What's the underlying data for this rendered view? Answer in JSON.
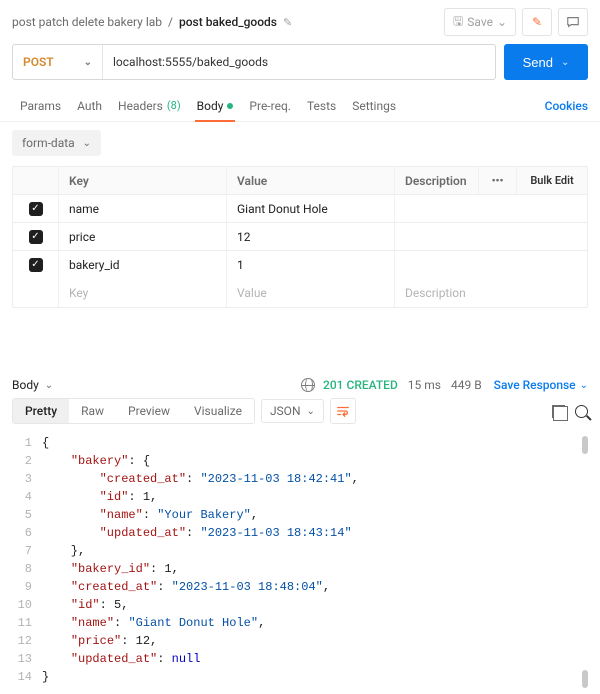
{
  "breadcrumb": {
    "workspace": "post patch delete bakery lab",
    "separator": "/",
    "request": "post baked_goods"
  },
  "actions": {
    "save": "Save"
  },
  "request": {
    "method": "POST",
    "url": "localhost:5555/baked_goods",
    "send": "Send"
  },
  "tabs": {
    "params": "Params",
    "auth": "Auth",
    "headers": "Headers",
    "headers_count": "(8)",
    "body": "Body",
    "prereq": "Pre-req.",
    "tests": "Tests",
    "settings": "Settings",
    "cookies": "Cookies"
  },
  "body": {
    "type": "form-data",
    "columns": {
      "key": "Key",
      "value": "Value",
      "desc": "Description",
      "bulk": "Bulk Edit"
    },
    "rows": [
      {
        "key": "name",
        "value": "Giant Donut Hole"
      },
      {
        "key": "price",
        "value": "12"
      },
      {
        "key": "bakery_id",
        "value": "1"
      }
    ],
    "placeholders": {
      "key": "Key",
      "value": "Value",
      "desc": "Description"
    }
  },
  "response": {
    "dropdown": "Body",
    "status_code": "201",
    "status_text": "CREATED",
    "time": "15 ms",
    "size": "449 B",
    "save": "Save Response",
    "views": {
      "pretty": "Pretty",
      "raw": "Raw",
      "preview": "Preview",
      "visualize": "Visualize"
    },
    "lang": "JSON",
    "json_lines": [
      "{",
      "    \"bakery\": {",
      "        \"created_at\": \"2023-11-03 18:42:41\",",
      "        \"id\": 1,",
      "        \"name\": \"Your Bakery\",",
      "        \"updated_at\": \"2023-11-03 18:43:14\"",
      "    },",
      "    \"bakery_id\": 1,",
      "    \"created_at\": \"2023-11-03 18:48:04\",",
      "    \"id\": 5,",
      "    \"name\": \"Giant Donut Hole\",",
      "    \"price\": 12,",
      "    \"updated_at\": null",
      "}"
    ]
  }
}
